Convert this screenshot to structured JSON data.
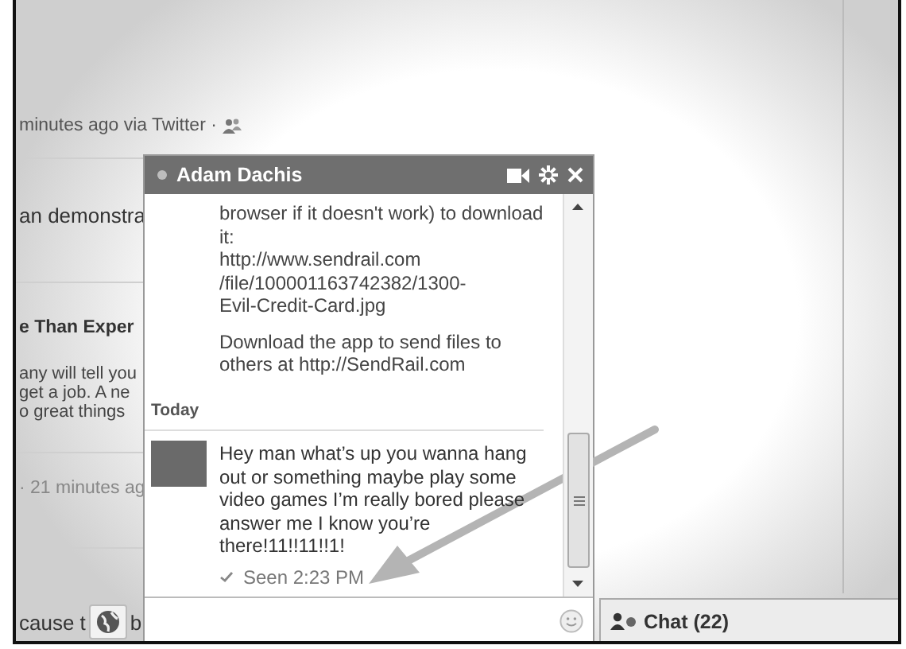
{
  "feed": [
    {
      "kind": "meta",
      "text": "minutes ago via Twitter ·"
    },
    {
      "kind": "text",
      "text": "an demonstra"
    },
    {
      "kind": "story",
      "title": "e Than Exper",
      "lines": [
        "any will tell you",
        "get a job. A ne",
        "o great things"
      ]
    },
    {
      "kind": "meta",
      "text": "· 21 minutes ag"
    },
    {
      "kind": "share",
      "text": "cause t",
      "after": "b"
    }
  ],
  "chat_window": {
    "title": "Adam Dachis",
    "online": true,
    "earlier_paragraphs": [
      [
        "browser if it doesn't work) to download",
        "it:",
        "http://www.sendrail.com",
        "/file/100001163742382/1300-",
        "Evil-Credit-Card.jpg"
      ],
      [
        "Download the app to send files to",
        "others at http://SendRail.com"
      ]
    ],
    "day_divider": "Today",
    "message_lines": [
      "Hey man what’s up you wanna hang",
      "out or something maybe play some",
      "video games I’m really bored please",
      "answer me I know you’re",
      "there!11!!11!!1!"
    ],
    "seen": "Seen 2:23 PM"
  },
  "chat_bar": {
    "label": "Chat (22)"
  }
}
